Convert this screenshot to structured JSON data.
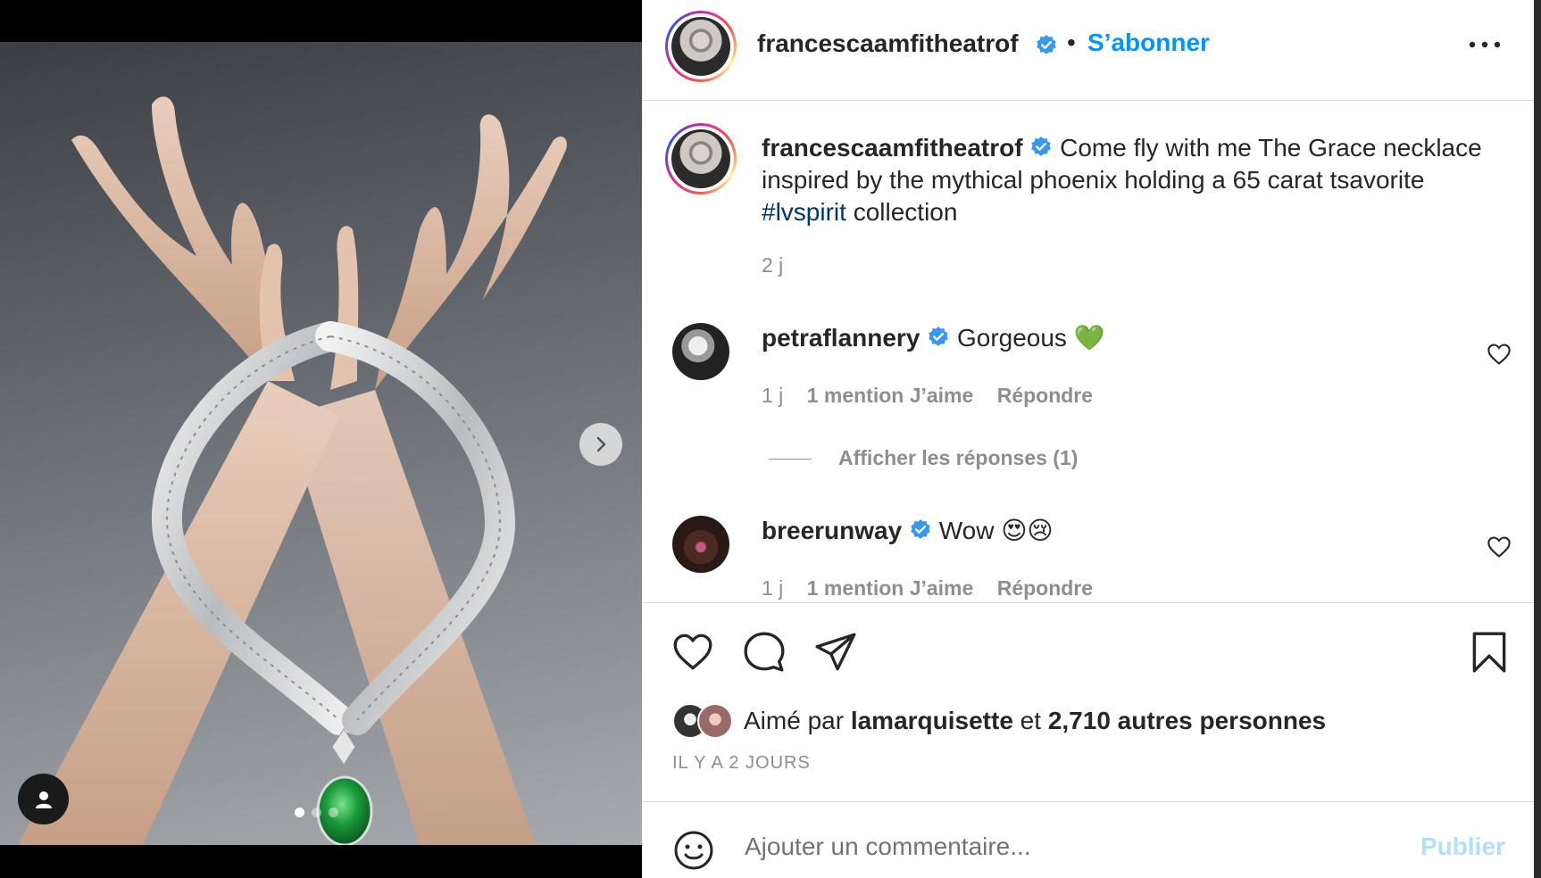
{
  "post": {
    "author": "francescaamfitheatrof",
    "follow_label": "S’abonner",
    "separator": "•",
    "carousel": {
      "current": 1,
      "total": 3
    }
  },
  "caption": {
    "author": "francescaamfitheatrof",
    "text_before": " Come fly with me The Grace necklace inspired by the mythical phoenix holding a 65 carat tsavorite ",
    "hashtag": "#lvspirit",
    "text_after": " collection",
    "time": "2 j"
  },
  "comments": [
    {
      "author": "petraflannery",
      "text": " Gorgeous 💚",
      "time": "1 j",
      "likes": "1 mention J’aime",
      "reply": "Répondre",
      "view_replies": "Afficher les réponses (1)"
    },
    {
      "author": "breerunway",
      "text": " Wow 😍😢",
      "time": "1 j",
      "likes": "1 mention J’aime",
      "reply": "Répondre"
    }
  ],
  "likes": {
    "prefix": "Aimé par ",
    "user": "lamarquisette",
    "middle": " et ",
    "count": "2,710 autres personnes"
  },
  "posted_ago": "IL Y A 2 JOURS",
  "composer": {
    "placeholder": "Ajouter un commentaire...",
    "publish_label": "Publier"
  },
  "colors": {
    "accent": "#0095f6",
    "publish_disabled": "#b2dffc",
    "hashtag": "#00376b",
    "secondary_text": "#8e8e8e",
    "verified": "#3897f0"
  },
  "icons": [
    "chevron-right-icon",
    "user-tag-icon",
    "more-icon",
    "verified-icon",
    "heart-icon",
    "comment-icon",
    "share-icon",
    "bookmark-icon",
    "emoji-icon"
  ]
}
